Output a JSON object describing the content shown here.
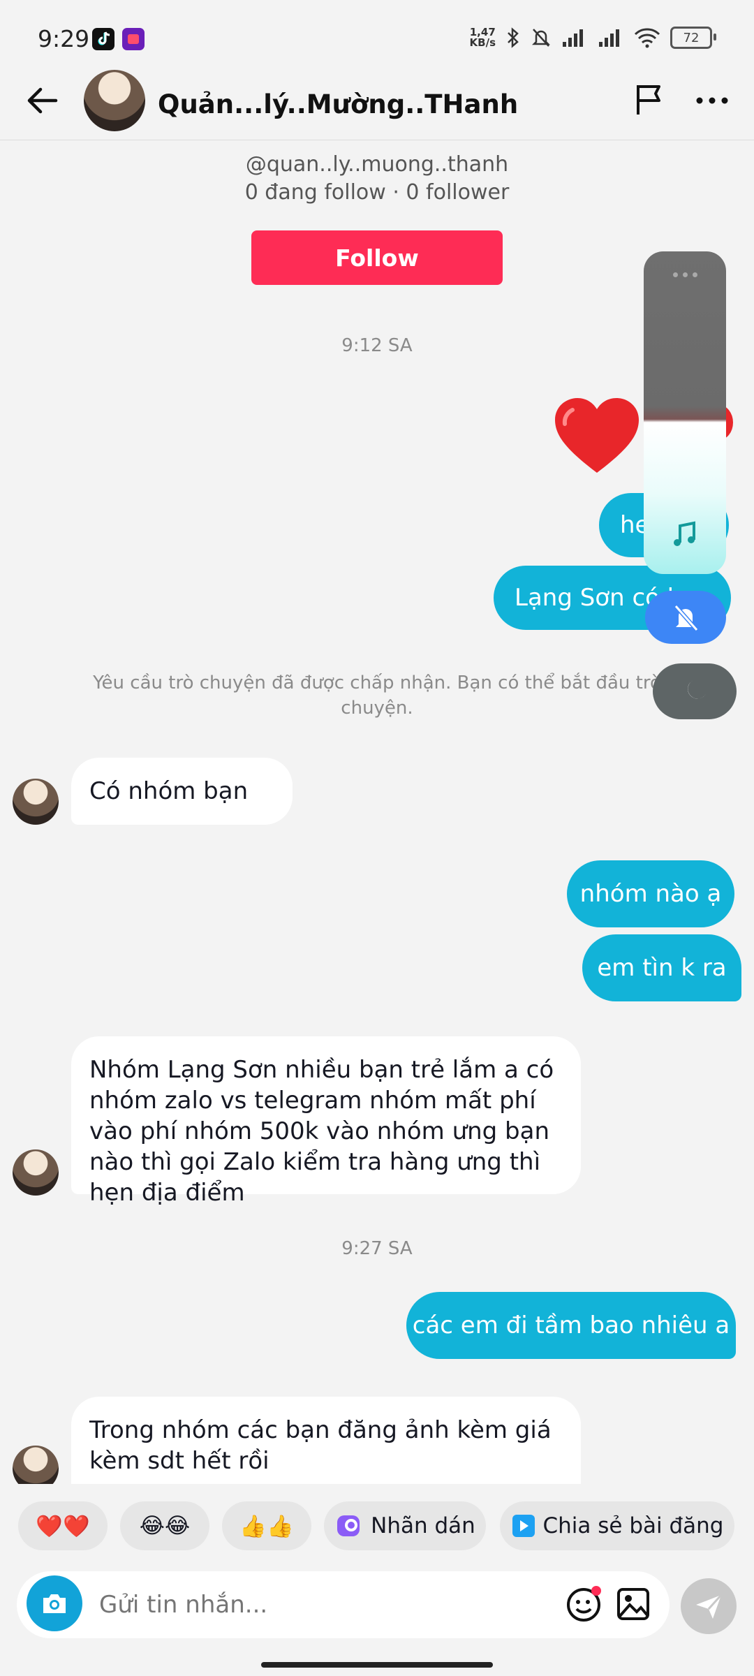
{
  "status_bar": {
    "time": "9:29",
    "net_speed_value": "1,47",
    "net_speed_unit": "KB/s",
    "battery": "72"
  },
  "header": {
    "title": "Quản...lý..Mường..THanh"
  },
  "profile": {
    "handle": "@quan..ly..muong..thanh",
    "stats": "0 đang follow · 0 follower",
    "follow_label": "Follow"
  },
  "messages": {
    "ts1": "9:12 SA",
    "out1_partial": "he",
    "out2_partial": "Lạng Sơn có b",
    "system_notice": "Yêu cầu trò chuyện đã được chấp nhận. Bạn có thể bắt đầu trò chuyện.",
    "in1": "Có nhóm bạn",
    "out3": "nhóm nào ạ",
    "out4": "em tìn k ra",
    "in2": "Nhóm Lạng Sơn nhiều bạn trẻ lắm a  có nhóm zalo vs telegram nhóm mất phí vào phí nhóm 500k vào nhóm ưng bạn nào thì gọi Zalo kiểm tra hàng ưng thì hẹn địa điểm",
    "ts2": "9:27 SA",
    "out5": "các em đi tầm bao nhiêu a",
    "in3": "Trong nhóm các bạn đăng ảnh kèm giá kèm sdt hết rồi"
  },
  "quick_replies": {
    "hearts": "❤️❤️",
    "laugh": "😂😂",
    "thumbs": "👍👍",
    "sticker": "Nhãn dán",
    "share_post": "Chia sẻ bài đăng"
  },
  "composer": {
    "placeholder": "Gửi tin nhắn..."
  },
  "colors": {
    "follow": "#fe2c55",
    "bubble_out": "#12b3d8",
    "accent_blue": "#3b82f6"
  }
}
